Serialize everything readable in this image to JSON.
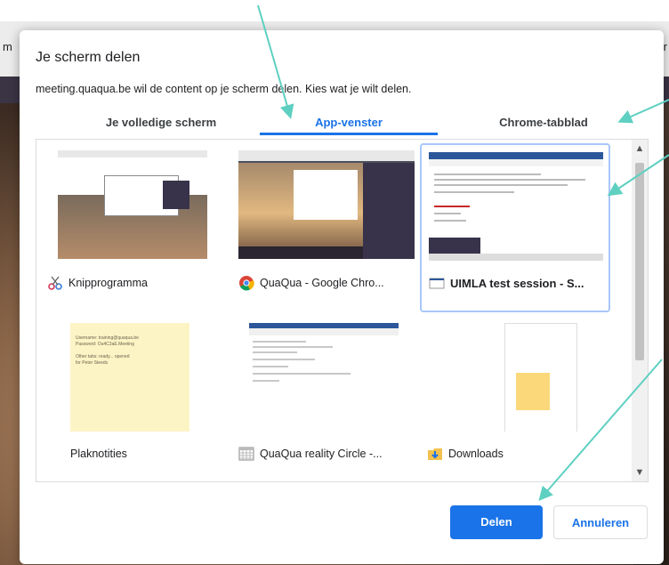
{
  "background": {
    "left_edge_text": "m",
    "right_edge_text": "r"
  },
  "dialog": {
    "title": "Je scherm delen",
    "subtitle": "meeting.quaqua.be wil de content op je scherm delen. Kies wat je wilt delen.",
    "tabs": [
      {
        "label": "Je volledige scherm",
        "selected": false
      },
      {
        "label": "App-venster",
        "selected": true
      },
      {
        "label": "Chrome-tabblad",
        "selected": false
      }
    ],
    "windows": [
      {
        "label": "Knipprogramma",
        "icon": "scissors-icon"
      },
      {
        "label": "QuaQua - Google Chro...",
        "icon": "chrome-icon"
      },
      {
        "label": "UIMLA test session - S...",
        "icon": "window-icon",
        "selected": true
      },
      {
        "label": "Plaknotities",
        "icon": "none"
      },
      {
        "label": "QuaQua reality Circle -...",
        "icon": "calendar-grid-icon"
      },
      {
        "label": "Downloads",
        "icon": "download-folder-icon"
      }
    ],
    "note_thumb_text": [
      "Username: training@quaqua.be",
      "Password: Ou4C3aE.Meeting",
      "",
      "Other tabs: ready... opened",
      "for Peter Steeds"
    ],
    "buttons": {
      "share": "Delen",
      "cancel": "Annuleren"
    }
  },
  "colors": {
    "accent": "#1a73e8",
    "annotation_arrow": "#5ed0c1",
    "selected_border": "#a8c7fa"
  }
}
